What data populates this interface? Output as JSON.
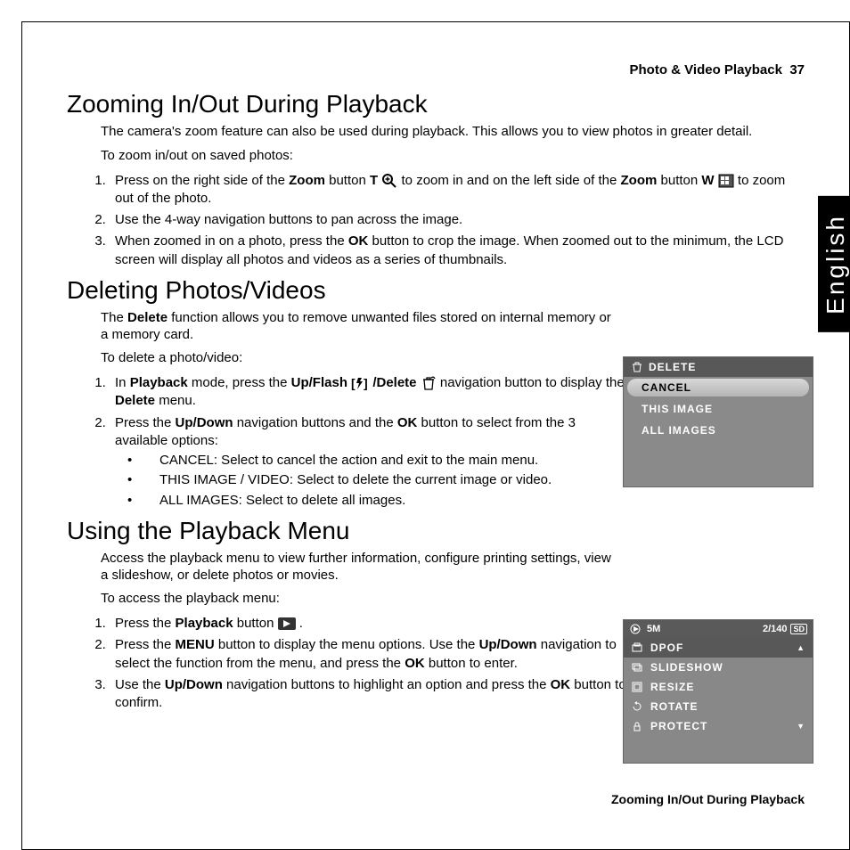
{
  "header": {
    "section": "Photo & Video Playback",
    "page_num": "37"
  },
  "sidebar": {
    "lang": "English"
  },
  "sec1": {
    "title": "Zooming In/Out During Playback",
    "intro": "The camera's zoom feature can also be used during playback. This allows you to view photos in greater detail.",
    "lead": "To zoom in/out on saved photos:",
    "step1_a": "Press on the right side of the ",
    "step1_b": " button ",
    "step1_c": " to zoom in and on the left side of the ",
    "step1_d": " button ",
    "step1_e": " to zoom out of the photo.",
    "t_label": "T",
    "w_label": "W",
    "zoom_word": "Zoom",
    "step2": "Use the 4-way navigation buttons to pan across the image.",
    "step3_a": "When zoomed in on a photo, press the ",
    "step3_b": " button to crop the image. When zoomed out to the minimum, the LCD screen will display all photos and videos as a series of thumbnails.",
    "ok_word": "OK"
  },
  "sec2": {
    "title": "Deleting Photos/Videos",
    "intro_a": "The ",
    "intro_b": " function allows you to remove unwanted files stored on internal memory or a memory card.",
    "delete_word": "Delete",
    "lead": "To delete a photo/video:",
    "step1_a": "In ",
    "step1_b": " mode, press the ",
    "step1_c": " navigation button to display the ",
    "step1_d": " menu.",
    "playback_word": "Playback",
    "upflash_word": "Up/Flash",
    "slash_delete": "/Delete",
    "step2_a": "Press the ",
    "step2_b": " navigation buttons and the ",
    "step2_c": " button to select from the 3 available options:",
    "updown_word": "Up/Down",
    "ok_word": "OK",
    "opt1": "CANCEL: Select to cancel the action and exit to the main menu.",
    "opt2": "THIS IMAGE / VIDEO: Select to delete the current image or video.",
    "opt3": "ALL IMAGES: Select to delete all images."
  },
  "sec3": {
    "title": "Using the Playback Menu",
    "intro": "Access the playback menu to view further information, configure printing settings, view a slideshow, or delete photos or movies.",
    "lead": "To access the playback menu:",
    "step1_a": "Press the ",
    "step1_b": " button ",
    "step1_c": ".",
    "playback_word": "Playback",
    "step2_a": "Press the ",
    "step2_b": " button to display the menu options. Use the ",
    "step2_c": " navigation to select the function from the menu, and press the ",
    "step2_d": " button to enter.",
    "menu_word": "MENU",
    "updown_word": "Up/Down",
    "ok_word": "OK",
    "step3_a": "Use the ",
    "step3_b": " navigation buttons to highlight an option and press the ",
    "step3_c": " button to confirm."
  },
  "lcd1": {
    "title": "DELETE",
    "rows": [
      "CANCEL",
      "THIS IMAGE",
      "ALL IMAGES"
    ]
  },
  "lcd2": {
    "top_left": "5M",
    "top_right_count": "2/140",
    "top_right_sd": "SD",
    "rows": [
      "DPOF",
      "SLIDESHOW",
      "RESIZE",
      "ROTATE",
      "PROTECT"
    ]
  },
  "footer": {
    "text": "Zooming In/Out During Playback"
  }
}
